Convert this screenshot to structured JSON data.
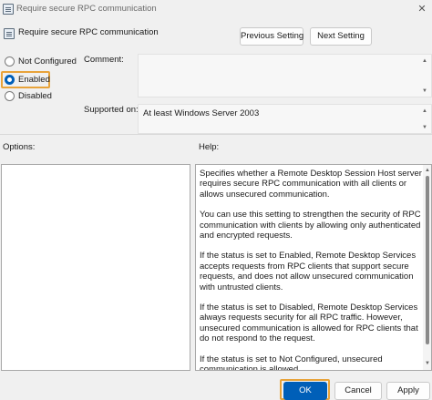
{
  "window": {
    "title": "Require secure RPC communication",
    "icon": "policy-icon"
  },
  "header": {
    "setting_name": "Require secure RPC communication",
    "prev_label": "Previous Setting",
    "next_label": "Next Setting"
  },
  "state": {
    "options": [
      {
        "label": "Not Configured",
        "checked": false
      },
      {
        "label": "Enabled",
        "checked": true
      },
      {
        "label": "Disabled",
        "checked": false
      }
    ]
  },
  "comment": {
    "label": "Comment:",
    "value": ""
  },
  "supported": {
    "label": "Supported on:",
    "value": "At least Windows Server 2003"
  },
  "options_panel": {
    "label": "Options:"
  },
  "help_panel": {
    "label": "Help:",
    "paragraphs": [
      "Specifies whether a Remote Desktop Session Host server requires secure RPC communication with all clients or allows unsecured communication.",
      "You can use this setting to strengthen the security of RPC communication with clients by allowing only authenticated and encrypted requests.",
      "If the status is set to Enabled, Remote Desktop Services accepts requests from RPC clients that support secure requests, and does not allow unsecured communication with untrusted clients.",
      "If the status is set to Disabled, Remote Desktop Services always requests security for all RPC traffic. However, unsecured communication is allowed for RPC clients that do not respond to the request.",
      "If the status is set to Not Configured, unsecured communication is allowed."
    ]
  },
  "footer": {
    "ok_label": "OK",
    "cancel_label": "Cancel",
    "apply_label": "Apply"
  },
  "colors": {
    "accent": "#005fb8",
    "highlight": "#e8a33a"
  }
}
